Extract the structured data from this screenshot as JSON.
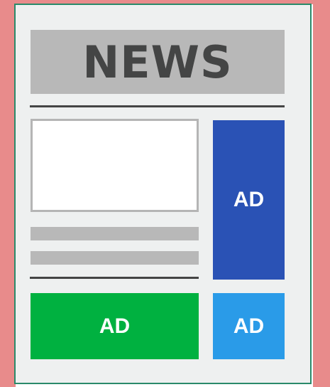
{
  "colors": {
    "backdrop": "#e88b8b",
    "page": "#eef0f0",
    "page_border": "#2a8a6a",
    "masthead_bg": "#b8b8b8",
    "masthead_text": "#444545",
    "rule": "#444545",
    "photo_fill": "#ffffff",
    "text_line": "#b8b8b8",
    "ad_tall": "#2a52b5",
    "ad_wide": "#00b140",
    "ad_small": "#2a9be8"
  },
  "masthead": {
    "title": "NEWS"
  },
  "ads": {
    "tall": "AD",
    "wide": "AD",
    "small": "AD"
  }
}
